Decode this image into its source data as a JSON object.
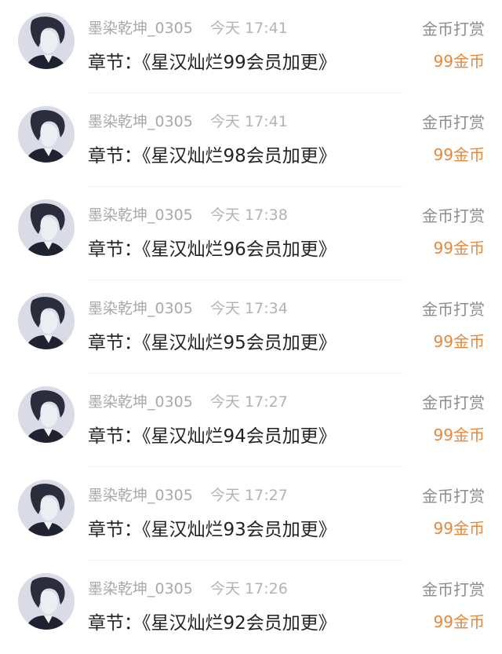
{
  "tip_records": [
    {
      "username": "墨染乾坤_0305",
      "time": "今天 17:41",
      "chapter": "章节：《星汉灿烂99会员加更》",
      "tip_label": "金币打赏",
      "tip_amount": "99金币"
    },
    {
      "username": "墨染乾坤_0305",
      "time": "今天 17:41",
      "chapter": "章节：《星汉灿烂98会员加更》",
      "tip_label": "金币打赏",
      "tip_amount": "99金币"
    },
    {
      "username": "墨染乾坤_0305",
      "time": "今天 17:38",
      "chapter": "章节：《星汉灿烂96会员加更》",
      "tip_label": "金币打赏",
      "tip_amount": "99金币"
    },
    {
      "username": "墨染乾坤_0305",
      "time": "今天 17:34",
      "chapter": "章节：《星汉灿烂95会员加更》",
      "tip_label": "金币打赏",
      "tip_amount": "99金币"
    },
    {
      "username": "墨染乾坤_0305",
      "time": "今天 17:27",
      "chapter": "章节：《星汉灿烂94会员加更》",
      "tip_label": "金币打赏",
      "tip_amount": "99金币"
    },
    {
      "username": "墨染乾坤_0305",
      "time": "今天 17:27",
      "chapter": "章节：《星汉灿烂93会员加更》",
      "tip_label": "金币打赏",
      "tip_amount": "99金币"
    },
    {
      "username": "墨染乾坤_0305",
      "time": "今天 17:26",
      "chapter": "章节：《星汉灿烂92会员加更》",
      "tip_label": "金币打赏",
      "tip_amount": "99金币"
    }
  ],
  "colors": {
    "username": "#a9a9a9",
    "time": "#b3b3b3",
    "chapter": "#222222",
    "tip_label": "#8c8c8c",
    "tip_amount": "#e8873a"
  },
  "icons": {
    "avatar": "user-avatar-icon"
  }
}
